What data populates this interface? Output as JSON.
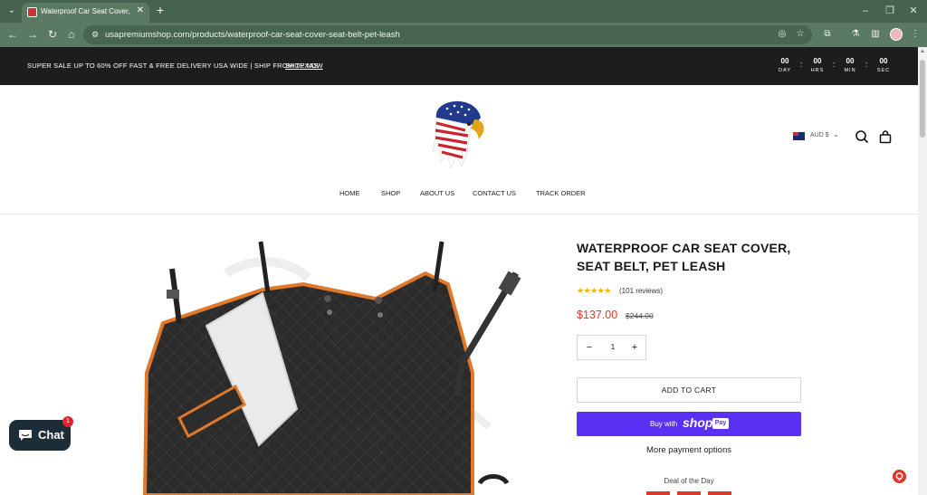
{
  "browser": {
    "tab_title": "Waterproof Car Seat Cover, Se",
    "url": "usapremiumshop.com/products/waterproof-car-seat-cover-seat-belt-pet-leash"
  },
  "announcement": {
    "text": "SUPER SALE UP TO 60% OFF FAST & FREE DELIVERY USA WIDE | SHIP FROM TEXAS",
    "link": "SHOP NOW"
  },
  "countdown": [
    {
      "value": "00",
      "label": "DAY"
    },
    {
      "value": "00",
      "label": "HRS"
    },
    {
      "value": "00",
      "label": "MIN"
    },
    {
      "value": "00",
      "label": "SEC"
    }
  ],
  "header": {
    "currency": "AUD $",
    "icons": [
      "flag-australia-icon",
      "search-icon",
      "cart-icon"
    ]
  },
  "nav": [
    "HOME",
    "SHOP",
    "ABOUT US",
    "CONTACT US",
    "TRACK ORDER"
  ],
  "product": {
    "title": "WATERPROOF CAR SEAT COVER, SEAT BELT, PET LEASH",
    "stars": "★★★★★",
    "reviews": "(101 reviews)",
    "price": "$137.00",
    "compare_price": "$244.00",
    "quantity": "1",
    "add_to_cart": "ADD TO CART",
    "buy_with": "Buy with",
    "shop_word": "shop",
    "pay_badge": "Pay",
    "more_payment": "More payment options",
    "deal": "Deal of the Day"
  },
  "chat": {
    "label": "Chat",
    "badge": "1"
  },
  "colors": {
    "accent_price": "#e0392c",
    "shop_pay": "#5a31f4",
    "announcement_bg": "#1d1d1d",
    "chrome_green": "#45634f"
  }
}
